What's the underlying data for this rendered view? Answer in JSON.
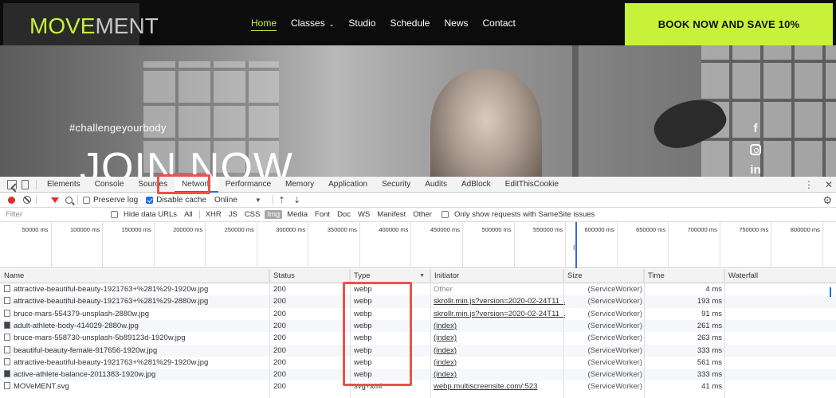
{
  "site": {
    "logo_part1": "MOVE",
    "logo_part2": "MENT",
    "nav": [
      {
        "label": "Home",
        "active": true
      },
      {
        "label": "Classes",
        "active": false
      },
      {
        "label": "Studio",
        "active": false
      },
      {
        "label": "Schedule",
        "active": false
      },
      {
        "label": "News",
        "active": false
      },
      {
        "label": "Contact",
        "active": false
      }
    ],
    "classes_caret": "⌄",
    "cta": "BOOK NOW AND SAVE 10%",
    "hero_tag": "#challengeyourbody",
    "hero_title": "JOIN NOW",
    "social": [
      "facebook-icon",
      "instagram-icon",
      "linkedin-icon"
    ],
    "social_glyphs": {
      "facebook": "f",
      "linkedin": "in"
    },
    "accent_color": "#c8f23a"
  },
  "devtools": {
    "tabs": [
      "Elements",
      "Console",
      "Sources",
      "Network",
      "Performance",
      "Memory",
      "Application",
      "Security",
      "Audits",
      "AdBlock",
      "EditThisCookie"
    ],
    "active_tab": "Network",
    "tabs_right": {
      "more": "⋮",
      "close": "✕"
    },
    "toolbar": {
      "preserve_log": "Preserve log",
      "disable_cache": "Disable cache",
      "throttle": "Online",
      "upload_arrow": "⇡",
      "download_arrow": "⇣",
      "gear": "⚙",
      "dd_caret": "▼"
    },
    "filterbar": {
      "placeholder": "Filter",
      "hide_data_urls": "Hide data URLs",
      "types": [
        "All",
        "XHR",
        "JS",
        "CSS",
        "Img",
        "Media",
        "Font",
        "Doc",
        "WS",
        "Manifest",
        "Other"
      ],
      "selected_type": "Img",
      "samesite": "Only show requests with SameSite issues"
    },
    "overview_ticks": [
      "50000 ms",
      "100000 ms",
      "150000 ms",
      "200000 ms",
      "250000 ms",
      "300000 ms",
      "350000 ms",
      "400000 ms",
      "450000 ms",
      "500000 ms",
      "550000 ms",
      "600000 ms",
      "650000 ms",
      "700000 ms",
      "750000 ms",
      "800000 ms"
    ],
    "overview_cursor": "I",
    "columns": [
      "Name",
      "Status",
      "Type",
      "Initiator",
      "Size",
      "Time",
      "Waterfall"
    ],
    "type_sort_caret": "▼",
    "rows": [
      {
        "name": "attractive-beautiful-beauty-1921763+%281%29-1920w.jpg",
        "status": "200",
        "type": "webp",
        "initiator": "Other",
        "initiator_link": false,
        "size": "(ServiceWorker)",
        "time": "4 ms",
        "icon": "image-file-icon"
      },
      {
        "name": "attractive-beautiful-beauty-1921763+%281%29-2880w.jpg",
        "status": "200",
        "type": "webp",
        "initiator": "skrollr.min.js?version=2020-02-24T11_...",
        "initiator_link": true,
        "size": "(ServiceWorker)",
        "time": "193 ms",
        "icon": "image-file-icon"
      },
      {
        "name": "bruce-mars-554379-unsplash-2880w.jpg",
        "status": "200",
        "type": "webp",
        "initiator": "skrollr.min.js?version=2020-02-24T11_...",
        "initiator_link": true,
        "size": "(ServiceWorker)",
        "time": "91 ms",
        "icon": "image-file-icon"
      },
      {
        "name": "adult-athlete-body-414029-2880w.jpg",
        "status": "200",
        "type": "webp",
        "initiator": "(index)",
        "initiator_link": true,
        "size": "(ServiceWorker)",
        "time": "261 ms",
        "icon": "dark-image-file-icon"
      },
      {
        "name": "bruce-mars-558730-unsplash-5b89123d-1920w.jpg",
        "status": "200",
        "type": "webp",
        "initiator": "(index)",
        "initiator_link": true,
        "size": "(ServiceWorker)",
        "time": "263 ms",
        "icon": "image-file-icon"
      },
      {
        "name": "beautiful-beauty-female-917656-1920w.jpg",
        "status": "200",
        "type": "webp",
        "initiator": "(index)",
        "initiator_link": true,
        "size": "(ServiceWorker)",
        "time": "333 ms",
        "icon": "image-file-icon"
      },
      {
        "name": "attractive-beautiful-beauty-1921763+%281%29-1920w.jpg",
        "status": "200",
        "type": "webp",
        "initiator": "(index)",
        "initiator_link": true,
        "size": "(ServiceWorker)",
        "time": "561 ms",
        "icon": "image-file-icon"
      },
      {
        "name": "active-athlete-balance-2011383-1920w.jpg",
        "status": "200",
        "type": "webp",
        "initiator": "(index)",
        "initiator_link": true,
        "size": "(ServiceWorker)",
        "time": "333 ms",
        "icon": "dark-image-file-icon"
      },
      {
        "name": "MOVeMENT.svg",
        "status": "200",
        "type": "svg+xml",
        "initiator": "webp.multiscreensite.com/:523",
        "initiator_link": true,
        "size": "(ServiceWorker)",
        "time": "41 ms",
        "icon": "svg-file-icon"
      }
    ],
    "highlight_color": "#e8544c"
  }
}
